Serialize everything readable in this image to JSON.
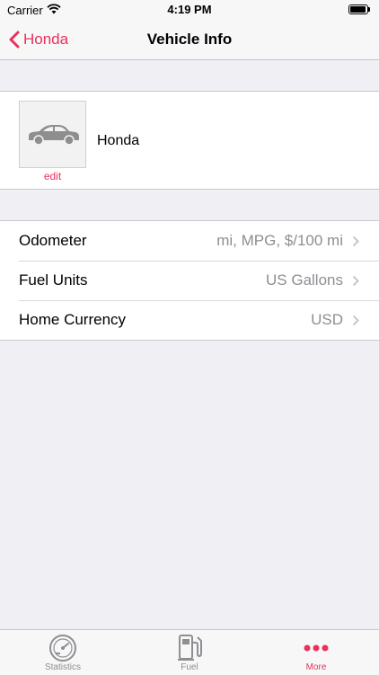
{
  "status_bar": {
    "carrier": "Carrier",
    "time": "4:19 PM"
  },
  "nav": {
    "back_label": "Honda",
    "title": "Vehicle Info"
  },
  "vehicle": {
    "name": "Honda",
    "edit_label": "edit"
  },
  "settings": [
    {
      "label": "Odometer",
      "value": "mi, MPG, $/100 mi"
    },
    {
      "label": "Fuel Units",
      "value": "US Gallons"
    },
    {
      "label": "Home Currency",
      "value": "USD"
    }
  ],
  "tabs": [
    {
      "label": "Statistics",
      "icon": "gauge-icon",
      "active": false
    },
    {
      "label": "Fuel",
      "icon": "fuel-pump-icon",
      "active": false
    },
    {
      "label": "More",
      "icon": "more-dots-icon",
      "active": true
    }
  ],
  "colors": {
    "accent": "#e8315b",
    "secondary_text": "#8e8e93",
    "background": "#efeff4"
  }
}
